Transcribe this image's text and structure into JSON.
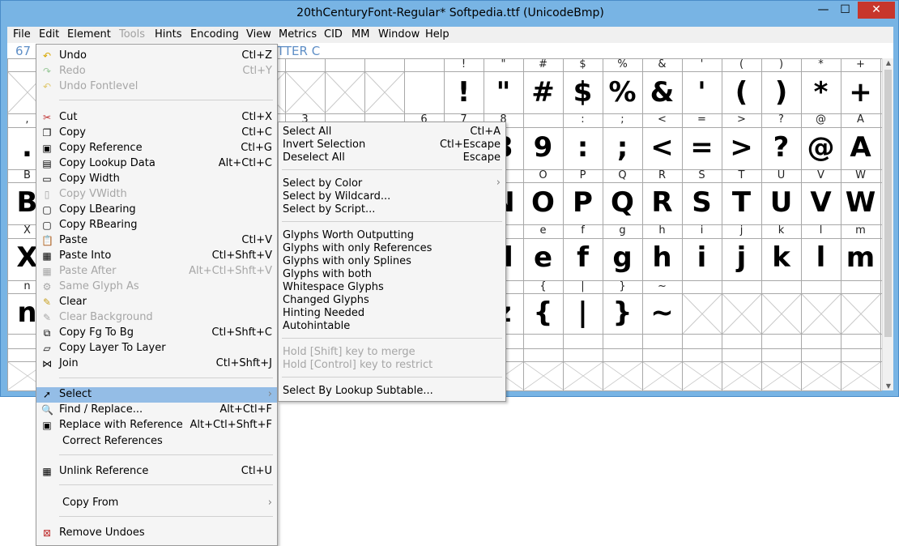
{
  "window": {
    "title": "20thCenturyFont-Regular*  Softpedia.ttf (UnicodeBmp)",
    "minimize_symbol": "—",
    "maximize_symbol": "☐",
    "close_symbol": "✕"
  },
  "menubar": [
    "File",
    "Edit",
    "Element",
    "Tools",
    "Hints",
    "Encoding",
    "View",
    "Metrics",
    "CID",
    "MM",
    "Window",
    "Help"
  ],
  "info": {
    "left": "67",
    "right": "TTER C"
  },
  "grid": {
    "row1_labels": [
      "!",
      "\"",
      "#",
      "$",
      "%",
      "&",
      "'",
      "(",
      ")",
      "*",
      "+"
    ],
    "row1_glyphs": [
      "!",
      "\"",
      "#",
      "$",
      "%",
      "&",
      "'",
      "(",
      ")",
      "*",
      "+"
    ],
    "row2_labels_left": [
      ",",
      "",
      "3",
      "",
      "6",
      "7",
      "8"
    ],
    "row2_labels": [
      ":",
      ";",
      "<",
      "=",
      ">",
      "?",
      "@",
      "A"
    ],
    "row2_glyphs": [
      ":",
      ";",
      "<",
      "=",
      ">",
      "?",
      "@",
      "A"
    ],
    "row2_glyph_left": ".",
    "row2_glyph_partial": "8",
    "row2_glyph_9": "9",
    "row3_labels": [
      "B",
      "O",
      "P",
      "Q",
      "R",
      "S",
      "T",
      "U",
      "V",
      "W"
    ],
    "row3_glyphs": [
      "B",
      "N",
      "O",
      "P",
      "Q",
      "R",
      "S",
      "T",
      "U",
      "V",
      "W"
    ],
    "row4_labels": [
      "X",
      "e",
      "f",
      "g",
      "h",
      "i",
      "j",
      "k",
      "l",
      "m"
    ],
    "row4_glyphs": [
      "X",
      "d",
      "e",
      "f",
      "g",
      "h",
      "i",
      "j",
      "k",
      "l",
      "m"
    ],
    "row5_labels": [
      "n",
      "{",
      "|",
      "}",
      "~"
    ],
    "row5_glyphs": [
      "n",
      "z",
      "{",
      "|",
      "}",
      "~"
    ]
  },
  "edit_menu": {
    "undo": {
      "label": "Undo",
      "shortcut": "Ctl+Z"
    },
    "redo": {
      "label": "Redo",
      "shortcut": "Ctl+Y"
    },
    "undo_fontlevel": {
      "label": "Undo Fontlevel"
    },
    "cut": {
      "label": "Cut",
      "shortcut": "Ctl+X"
    },
    "copy": {
      "label": "Copy",
      "shortcut": "Ctl+C"
    },
    "copy_reference": {
      "label": "Copy Reference",
      "shortcut": "Ctl+G"
    },
    "copy_lookup_data": {
      "label": "Copy Lookup Data",
      "shortcut": "Alt+Ctl+C"
    },
    "copy_width": {
      "label": "Copy Width"
    },
    "copy_vwidth": {
      "label": "Copy VWidth"
    },
    "copy_lbearing": {
      "label": "Copy LBearing"
    },
    "copy_rbearing": {
      "label": "Copy RBearing"
    },
    "paste": {
      "label": "Paste",
      "shortcut": "Ctl+V"
    },
    "paste_into": {
      "label": "Paste Into",
      "shortcut": "Ctl+Shft+V"
    },
    "paste_after": {
      "label": "Paste After",
      "shortcut": "Alt+Ctl+Shft+V"
    },
    "same_glyph_as": {
      "label": "Same Glyph As"
    },
    "clear": {
      "label": "Clear"
    },
    "clear_background": {
      "label": "Clear Background"
    },
    "copy_fg_to_bg": {
      "label": "Copy Fg To Bg",
      "shortcut": "Ctl+Shft+C"
    },
    "copy_layer_to_layer": {
      "label": "Copy Layer To Layer"
    },
    "join": {
      "label": "Join",
      "shortcut": "Ctl+Shft+J"
    },
    "select": {
      "label": "Select"
    },
    "find_replace": {
      "label": "Find / Replace...",
      "shortcut": "Alt+Ctl+F"
    },
    "replace_with_reference": {
      "label": "Replace with Reference",
      "shortcut": "Alt+Ctl+Shft+F"
    },
    "correct_references": {
      "label": "Correct References"
    },
    "unlink_reference": {
      "label": "Unlink Reference",
      "shortcut": "Ctl+U"
    },
    "copy_from": {
      "label": "Copy From"
    },
    "remove_undoes": {
      "label": "Remove Undoes"
    }
  },
  "select_menu": {
    "select_all": {
      "label": "Select All",
      "shortcut": "Ctl+A"
    },
    "invert_selection": {
      "label": "Invert Selection",
      "shortcut": "Ctl+Escape"
    },
    "deselect_all": {
      "label": "Deselect All",
      "shortcut": "Escape"
    },
    "select_by_color": {
      "label": "Select by Color"
    },
    "select_by_wildcard": {
      "label": "Select by Wildcard..."
    },
    "select_by_script": {
      "label": "Select by Script..."
    },
    "glyphs_worth_outputting": {
      "label": "Glyphs Worth Outputting"
    },
    "glyphs_only_references": {
      "label": "Glyphs with only References"
    },
    "glyphs_only_splines": {
      "label": "Glyphs with only Splines"
    },
    "glyphs_with_both": {
      "label": "Glyphs with both"
    },
    "whitespace_glyphs": {
      "label": "Whitespace Glyphs"
    },
    "changed_glyphs": {
      "label": "Changed Glyphs"
    },
    "hinting_needed": {
      "label": "Hinting Needed"
    },
    "autohintable": {
      "label": "Autohintable"
    },
    "hold_shift": {
      "label": "Hold [Shift] key to merge"
    },
    "hold_control": {
      "label": "Hold [Control] key to restrict"
    },
    "select_by_lookup_subtable": {
      "label": "Select By Lookup Subtable..."
    }
  }
}
